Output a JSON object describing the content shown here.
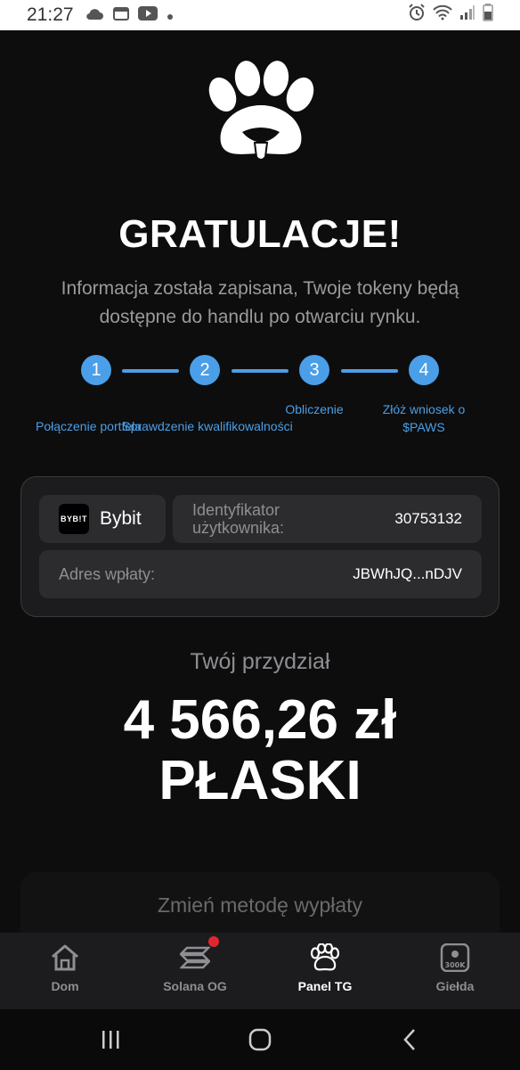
{
  "status_bar": {
    "time": "21:27"
  },
  "title": "GRATULACJE!",
  "subtitle": "Informacja została zapisana, Twoje tokeny będą dostępne do handlu po otwarciu rynku.",
  "steps": [
    {
      "number": "1",
      "label": "Połączenie portfela"
    },
    {
      "number": "2",
      "label": "Sprawdzenie kwalifikowalności"
    },
    {
      "number": "3",
      "label": "Obliczenie"
    },
    {
      "number": "4",
      "label": "Złóż wniosek o $PAWS"
    }
  ],
  "card": {
    "exchange_logo_text": "BYB!T",
    "exchange_name": "Bybit",
    "user_id_label": "Identyfikator użytkownika:",
    "user_id_value": "30753132",
    "address_label": "Adres wpłaty:",
    "address_value": "JBWhJQ...nDJV"
  },
  "allocation": {
    "label": "Twój przydział",
    "value_line1": "4 566,26 zł",
    "value_line2": "PŁASKI"
  },
  "change_method_label": "Zmień metodę wypłaty",
  "bottom_nav": [
    {
      "label": "Dom",
      "icon": "home-icon"
    },
    {
      "label": "Solana OG",
      "icon": "solana-icon"
    },
    {
      "label": "Panel TG",
      "icon": "paw-icon",
      "active": true
    },
    {
      "label": "Giełda",
      "icon": "exchange-300k-icon",
      "icon_text": "300K"
    }
  ],
  "colors": {
    "background": "#0d0d0d",
    "accent": "#4a9fe8",
    "badge": "#e0262f"
  }
}
